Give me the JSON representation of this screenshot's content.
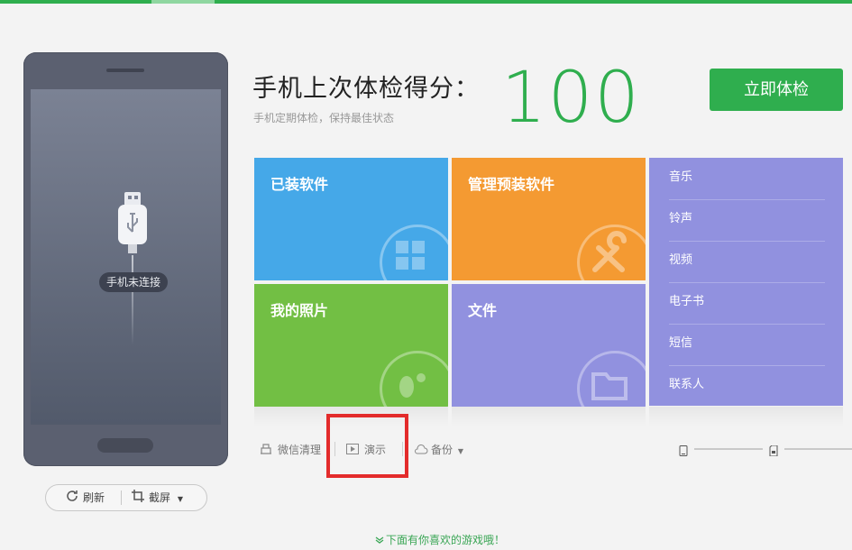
{
  "phone": {
    "status": "手机未连接",
    "refresh_label": "刷新",
    "screenshot_label": "截屏"
  },
  "header": {
    "title": "手机上次体检得分：",
    "subtitle": "手机定期体检，保持最佳状态",
    "score": "100",
    "check_button": "立即体检"
  },
  "tiles": {
    "installed": "已装软件",
    "preinstalled": "管理预装软件",
    "photos": "我的照片",
    "files": "文件"
  },
  "side_list": [
    "音乐",
    "铃声",
    "视频",
    "电子书",
    "短信",
    "联系人"
  ],
  "toolbar": {
    "wechat_clean": "微信清理",
    "demo": "演示",
    "backup": "备份"
  },
  "footer": {
    "hint": "下面有你喜欢的游戏哦！"
  },
  "colors": {
    "accent": "#2fae4e",
    "tile_blue": "#45a8e8",
    "tile_orange": "#f49a32",
    "tile_green": "#72bf44",
    "tile_purple": "#9191df",
    "highlight_red": "#e32b2b"
  }
}
